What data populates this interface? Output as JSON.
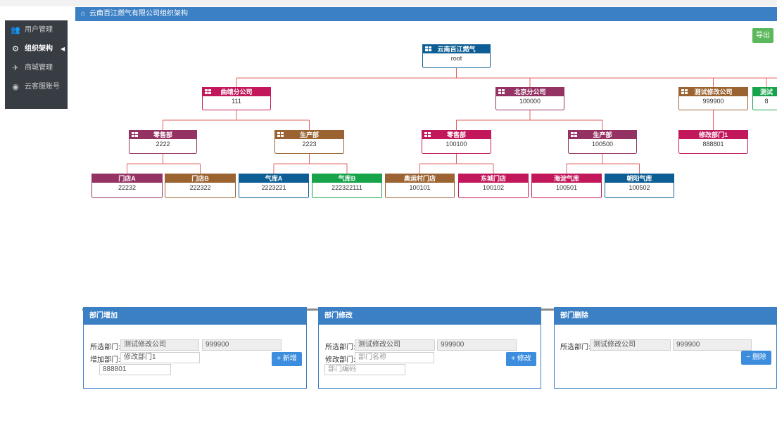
{
  "sidebar": {
    "items": [
      {
        "icon": "users-icon",
        "glyph": "👥",
        "label": "用户管理"
      },
      {
        "icon": "cogs-icon",
        "glyph": "⚙",
        "label": "组织架构"
      },
      {
        "icon": "plane-icon",
        "glyph": "✈",
        "label": "商城管理"
      },
      {
        "icon": "github-icon",
        "glyph": "◉",
        "label": "云客服账号"
      }
    ],
    "active_index": 1,
    "caret": "◀"
  },
  "header": {
    "home_icon": "⌂",
    "title": "云南百江燃气有限公司组织架构"
  },
  "export_label": "导出",
  "colors": {
    "accent": "#3b7fc4",
    "export": "#5cb85c",
    "node_blue": "#0d5e94",
    "node_magenta": "#c2185b",
    "node_plum": "#943263",
    "node_brown": "#9a6331",
    "node_green": "#16a34a",
    "connector": "#e26363"
  },
  "org_chart": {
    "nodes": [
      {
        "id": "root",
        "title": "云南百江燃气",
        "code": "root",
        "color": "blue",
        "icon": true
      },
      {
        "id": "qj",
        "parent": "root",
        "title": "曲靖分公司",
        "code": "111",
        "color": "magenta",
        "icon": true
      },
      {
        "id": "bj",
        "parent": "root",
        "title": "北京分公司",
        "code": "100000",
        "color": "plum",
        "icon": true
      },
      {
        "id": "cs",
        "parent": "root",
        "title": "测试修改公司",
        "code": "999900",
        "color": "brown",
        "icon": true
      },
      {
        "id": "cs2",
        "parent": "root",
        "title": "测试",
        "code": "8",
        "color": "green",
        "icon": false
      },
      {
        "id": "qj-ls",
        "parent": "qj",
        "title": "零售部",
        "code": "2222",
        "color": "plum",
        "icon": true
      },
      {
        "id": "qj-sc",
        "parent": "qj",
        "title": "生产部",
        "code": "2223",
        "color": "brown",
        "icon": true
      },
      {
        "id": "bj-ls",
        "parent": "bj",
        "title": "零售部",
        "code": "100100",
        "color": "magenta",
        "icon": true
      },
      {
        "id": "bj-sc",
        "parent": "bj",
        "title": "生产部",
        "code": "100500",
        "color": "plum",
        "icon": true
      },
      {
        "id": "cs-xg",
        "parent": "cs",
        "title": "修改部门1",
        "code": "888801",
        "color": "magenta",
        "icon": false
      },
      {
        "id": "mda",
        "parent": "qj-ls",
        "title": "门店A",
        "code": "22232",
        "color": "plum",
        "icon": false
      },
      {
        "id": "mdb",
        "parent": "qj-ls",
        "title": "门店B",
        "code": "222322",
        "color": "brown",
        "icon": false
      },
      {
        "id": "qka",
        "parent": "qj-sc",
        "title": "气库A",
        "code": "2223221",
        "color": "blue",
        "icon": false
      },
      {
        "id": "qkb",
        "parent": "qj-sc",
        "title": "气库B",
        "code": "222322111",
        "color": "green",
        "icon": false
      },
      {
        "id": "ayc",
        "parent": "bj-ls",
        "title": "奥运村门店",
        "code": "100101",
        "color": "brown",
        "icon": false
      },
      {
        "id": "dc",
        "parent": "bj-ls",
        "title": "东城门店",
        "code": "100102",
        "color": "magenta",
        "icon": false
      },
      {
        "id": "hd",
        "parent": "bj-sc",
        "title": "海淀气库",
        "code": "100501",
        "color": "magenta",
        "icon": false
      },
      {
        "id": "cy",
        "parent": "bj-sc",
        "title": "朝阳气库",
        "code": "100502",
        "color": "blue",
        "icon": false
      }
    ]
  },
  "panels": {
    "add": {
      "title": "部门增加",
      "selected_label": "所选部门:",
      "selected_name": "测试修改公司",
      "selected_code": "999900",
      "input_label": "增加部门:",
      "name_value": "修改部门1",
      "code_value": "888801",
      "button": "新增",
      "button_icon": "+"
    },
    "edit": {
      "title": "部门修改",
      "selected_label": "所选部门:",
      "selected_name": "测试修改公司",
      "selected_code": "999900",
      "input_label": "修改部门:",
      "name_placeholder": "部门名称",
      "code_placeholder": "部门编码",
      "button": "修改",
      "button_icon": "+"
    },
    "delete": {
      "title": "部门删除",
      "selected_label": "所选部门:",
      "selected_name": "测试修改公司",
      "selected_code": "999900",
      "button": "删除",
      "button_icon": "−"
    }
  }
}
